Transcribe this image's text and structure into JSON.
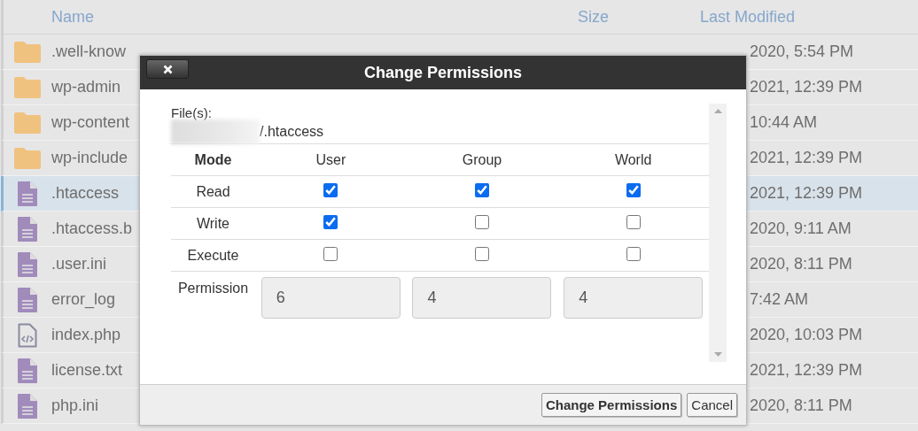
{
  "file_list": {
    "columns": [
      "Name",
      "Size",
      "Last Modified"
    ],
    "rows": [
      {
        "kind": "folder",
        "name": ".well-know",
        "selected": false,
        "modified": "2020, 5:54 PM"
      },
      {
        "kind": "folder",
        "name": "wp-admin",
        "selected": false,
        "modified": "2021, 12:39 PM"
      },
      {
        "kind": "folder",
        "name": "wp-content",
        "selected": false,
        "modified": "10:44 AM"
      },
      {
        "kind": "folder",
        "name": "wp-include",
        "selected": false,
        "modified": "2021, 12:39 PM"
      },
      {
        "kind": "file",
        "name": ".htaccess",
        "selected": true,
        "modified": "2021, 12:39 PM"
      },
      {
        "kind": "file",
        "name": ".htaccess.b",
        "selected": false,
        "modified": "2020, 9:11 AM"
      },
      {
        "kind": "file",
        "name": ".user.ini",
        "selected": false,
        "modified": "2020, 8:11 PM"
      },
      {
        "kind": "file",
        "name": "error_log",
        "selected": false,
        "modified": "7:42 AM"
      },
      {
        "kind": "code",
        "name": "index.php",
        "selected": false,
        "modified": "2020, 10:03 PM"
      },
      {
        "kind": "file",
        "name": "license.txt",
        "selected": false,
        "modified": "2021, 12:39 PM"
      },
      {
        "kind": "file",
        "name": "php.ini",
        "selected": false,
        "modified": "2020, 8:11 PM"
      }
    ]
  },
  "dialog": {
    "title": "Change Permissions",
    "files_label": "File(s):",
    "file_path": "/.htaccess",
    "columns": [
      "Mode",
      "User",
      "Group",
      "World"
    ],
    "modes": [
      {
        "label": "Read",
        "checks": [
          true,
          true,
          true
        ]
      },
      {
        "label": "Write",
        "checks": [
          true,
          false,
          false
        ]
      },
      {
        "label": "Execute",
        "checks": [
          false,
          false,
          false
        ]
      }
    ],
    "permission": {
      "label": "Permission",
      "values": [
        "6",
        "4",
        "4"
      ]
    },
    "buttons": [
      "Change Permissions",
      "Cancel"
    ]
  }
}
